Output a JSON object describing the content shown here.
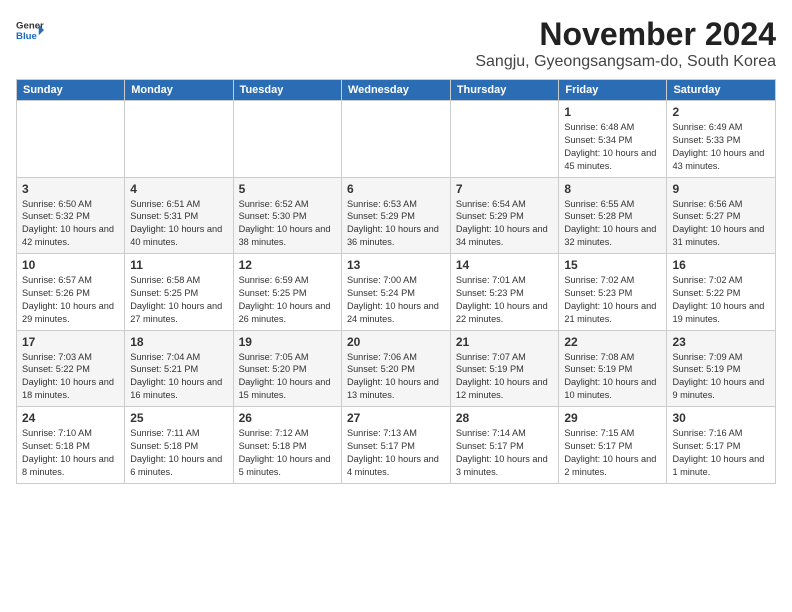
{
  "header": {
    "logo_line1": "General",
    "logo_line2": "Blue",
    "title": "November 2024",
    "subtitle": "Sangju, Gyeongsangsam-do, South Korea"
  },
  "columns": [
    "Sunday",
    "Monday",
    "Tuesday",
    "Wednesday",
    "Thursday",
    "Friday",
    "Saturday"
  ],
  "weeks": [
    [
      {
        "day": "",
        "info": ""
      },
      {
        "day": "",
        "info": ""
      },
      {
        "day": "",
        "info": ""
      },
      {
        "day": "",
        "info": ""
      },
      {
        "day": "",
        "info": ""
      },
      {
        "day": "1",
        "info": "Sunrise: 6:48 AM\nSunset: 5:34 PM\nDaylight: 10 hours and 45 minutes."
      },
      {
        "day": "2",
        "info": "Sunrise: 6:49 AM\nSunset: 5:33 PM\nDaylight: 10 hours and 43 minutes."
      }
    ],
    [
      {
        "day": "3",
        "info": "Sunrise: 6:50 AM\nSunset: 5:32 PM\nDaylight: 10 hours and 42 minutes."
      },
      {
        "day": "4",
        "info": "Sunrise: 6:51 AM\nSunset: 5:31 PM\nDaylight: 10 hours and 40 minutes."
      },
      {
        "day": "5",
        "info": "Sunrise: 6:52 AM\nSunset: 5:30 PM\nDaylight: 10 hours and 38 minutes."
      },
      {
        "day": "6",
        "info": "Sunrise: 6:53 AM\nSunset: 5:29 PM\nDaylight: 10 hours and 36 minutes."
      },
      {
        "day": "7",
        "info": "Sunrise: 6:54 AM\nSunset: 5:29 PM\nDaylight: 10 hours and 34 minutes."
      },
      {
        "day": "8",
        "info": "Sunrise: 6:55 AM\nSunset: 5:28 PM\nDaylight: 10 hours and 32 minutes."
      },
      {
        "day": "9",
        "info": "Sunrise: 6:56 AM\nSunset: 5:27 PM\nDaylight: 10 hours and 31 minutes."
      }
    ],
    [
      {
        "day": "10",
        "info": "Sunrise: 6:57 AM\nSunset: 5:26 PM\nDaylight: 10 hours and 29 minutes."
      },
      {
        "day": "11",
        "info": "Sunrise: 6:58 AM\nSunset: 5:25 PM\nDaylight: 10 hours and 27 minutes."
      },
      {
        "day": "12",
        "info": "Sunrise: 6:59 AM\nSunset: 5:25 PM\nDaylight: 10 hours and 26 minutes."
      },
      {
        "day": "13",
        "info": "Sunrise: 7:00 AM\nSunset: 5:24 PM\nDaylight: 10 hours and 24 minutes."
      },
      {
        "day": "14",
        "info": "Sunrise: 7:01 AM\nSunset: 5:23 PM\nDaylight: 10 hours and 22 minutes."
      },
      {
        "day": "15",
        "info": "Sunrise: 7:02 AM\nSunset: 5:23 PM\nDaylight: 10 hours and 21 minutes."
      },
      {
        "day": "16",
        "info": "Sunrise: 7:02 AM\nSunset: 5:22 PM\nDaylight: 10 hours and 19 minutes."
      }
    ],
    [
      {
        "day": "17",
        "info": "Sunrise: 7:03 AM\nSunset: 5:22 PM\nDaylight: 10 hours and 18 minutes."
      },
      {
        "day": "18",
        "info": "Sunrise: 7:04 AM\nSunset: 5:21 PM\nDaylight: 10 hours and 16 minutes."
      },
      {
        "day": "19",
        "info": "Sunrise: 7:05 AM\nSunset: 5:20 PM\nDaylight: 10 hours and 15 minutes."
      },
      {
        "day": "20",
        "info": "Sunrise: 7:06 AM\nSunset: 5:20 PM\nDaylight: 10 hours and 13 minutes."
      },
      {
        "day": "21",
        "info": "Sunrise: 7:07 AM\nSunset: 5:19 PM\nDaylight: 10 hours and 12 minutes."
      },
      {
        "day": "22",
        "info": "Sunrise: 7:08 AM\nSunset: 5:19 PM\nDaylight: 10 hours and 10 minutes."
      },
      {
        "day": "23",
        "info": "Sunrise: 7:09 AM\nSunset: 5:19 PM\nDaylight: 10 hours and 9 minutes."
      }
    ],
    [
      {
        "day": "24",
        "info": "Sunrise: 7:10 AM\nSunset: 5:18 PM\nDaylight: 10 hours and 8 minutes."
      },
      {
        "day": "25",
        "info": "Sunrise: 7:11 AM\nSunset: 5:18 PM\nDaylight: 10 hours and 6 minutes."
      },
      {
        "day": "26",
        "info": "Sunrise: 7:12 AM\nSunset: 5:18 PM\nDaylight: 10 hours and 5 minutes."
      },
      {
        "day": "27",
        "info": "Sunrise: 7:13 AM\nSunset: 5:17 PM\nDaylight: 10 hours and 4 minutes."
      },
      {
        "day": "28",
        "info": "Sunrise: 7:14 AM\nSunset: 5:17 PM\nDaylight: 10 hours and 3 minutes."
      },
      {
        "day": "29",
        "info": "Sunrise: 7:15 AM\nSunset: 5:17 PM\nDaylight: 10 hours and 2 minutes."
      },
      {
        "day": "30",
        "info": "Sunrise: 7:16 AM\nSunset: 5:17 PM\nDaylight: 10 hours and 1 minute."
      }
    ]
  ]
}
